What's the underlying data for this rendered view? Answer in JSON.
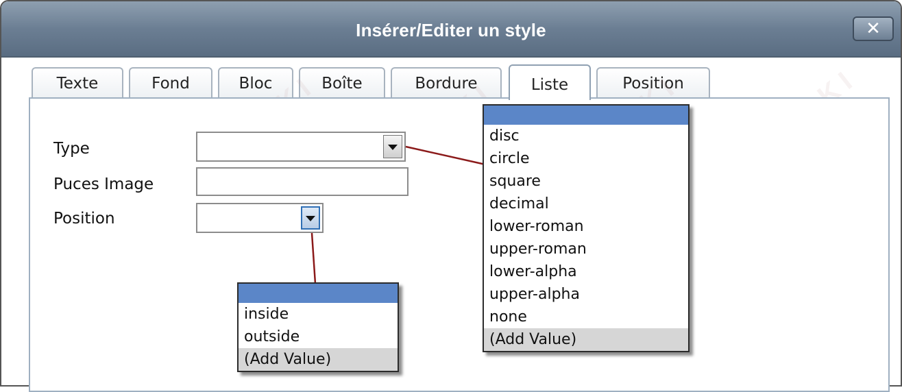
{
  "window": {
    "title": "Insérer/Editer un style",
    "close_label": "✕",
    "colors": {
      "titlebar": "#6b7e93",
      "selected_option": "#5b86c8",
      "connector": "#8b1a1a"
    }
  },
  "tabs": [
    {
      "label": "Texte"
    },
    {
      "label": "Fond"
    },
    {
      "label": "Bloc"
    },
    {
      "label": "Boîte"
    },
    {
      "label": "Bordure"
    },
    {
      "label": "Liste",
      "active": true
    },
    {
      "label": "Position"
    }
  ],
  "form": {
    "type_label": "Type",
    "type_value": "",
    "puces_label": "Puces Image",
    "puces_value": "",
    "position_label": "Position",
    "position_value": ""
  },
  "type_dropdown": {
    "selected": "",
    "options": [
      "disc",
      "circle",
      "square",
      "decimal",
      "lower-roman",
      "upper-roman",
      "lower-alpha",
      "upper-alpha",
      "none"
    ],
    "add_value": "(Add Value)"
  },
  "position_dropdown": {
    "selected": "",
    "options": [
      "inside",
      "outside"
    ],
    "add_value": "(Add Value)"
  },
  "watermark": "SARKI"
}
